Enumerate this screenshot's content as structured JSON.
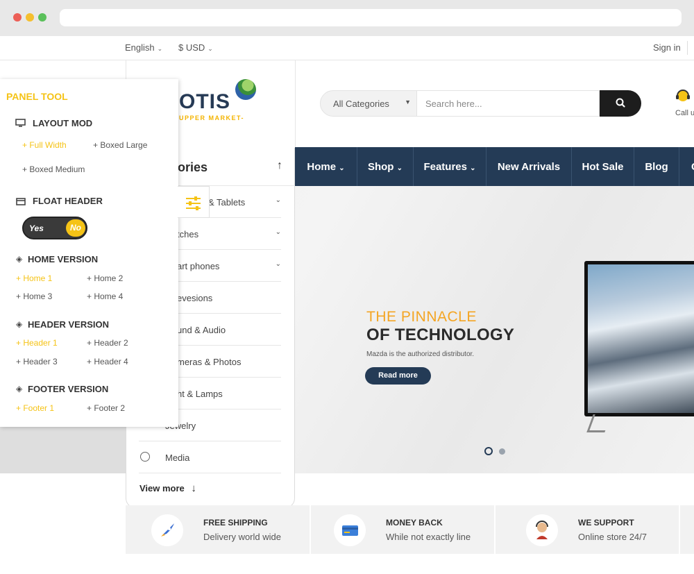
{
  "topbar": {
    "language": "English",
    "currency": "$ USD",
    "signin": "Sign in"
  },
  "header": {
    "logo_text": "OTIS",
    "logo_tag": "UPPER MARKET-",
    "search_category": "All Categories",
    "search_placeholder": "Search here...",
    "call_label": "Call u"
  },
  "nav": {
    "items": [
      "Home",
      "Shop",
      "Features",
      "New Arrivals",
      "Hot Sale",
      "Blog",
      "C"
    ]
  },
  "hero": {
    "title1": "THE PINNACLE",
    "title2": "OF TECHNOLOGY",
    "subtitle": "Mazda is the authorized distributor.",
    "button": "Read more",
    "slide_count": 2,
    "active_slide": 1
  },
  "categories": {
    "title": "ories",
    "items": [
      {
        "label": "& Tablets",
        "has_sub": true
      },
      {
        "label": "tches",
        "has_sub": true
      },
      {
        "label": "art phones",
        "has_sub": true
      },
      {
        "label": "evesions",
        "has_sub": false
      },
      {
        "label": "und & Audio",
        "has_sub": false
      },
      {
        "label": "meras & Photos",
        "has_sub": false
      },
      {
        "label": "ht & Lamps",
        "has_sub": false
      },
      {
        "label": "Jewelry",
        "has_sub": false
      },
      {
        "label": "Media",
        "has_sub": false
      }
    ],
    "view_more": "View more"
  },
  "panel": {
    "title": "PANEL TOOL",
    "layout_mod": {
      "label": "LAYOUT MOD",
      "options": [
        "+ Full Width",
        "+ Boxed Large",
        "+ Boxed Medium"
      ]
    },
    "float_header": {
      "label": "FLOAT HEADER",
      "yes": "Yes",
      "no": "No"
    },
    "home_version": {
      "label": "HOME VERSION",
      "options": [
        "+ Home 1",
        "+ Home 2",
        "+ Home 3",
        "+ Home 4"
      ]
    },
    "header_version": {
      "label": "HEADER VERSION",
      "options": [
        "+ Header 1",
        "+ Header 2",
        "+ Header 3",
        "+ Header 4"
      ]
    },
    "footer_version": {
      "label": "FOOTER VERSION",
      "options": [
        "+ Footer 1",
        "+ Footer 2"
      ]
    }
  },
  "features": [
    {
      "title": "FREE SHIPPING",
      "sub": "Delivery world wide",
      "icon": "rocket-icon"
    },
    {
      "title": "MONEY BACK",
      "sub": "While not exactly line",
      "icon": "credit-card-icon"
    },
    {
      "title": "WE SUPPORT",
      "sub": "Online store 24/7",
      "icon": "support-agent-icon"
    }
  ],
  "colors": {
    "accent": "#f5c316",
    "nav": "#243b56",
    "hero_orange": "#f4a523"
  }
}
